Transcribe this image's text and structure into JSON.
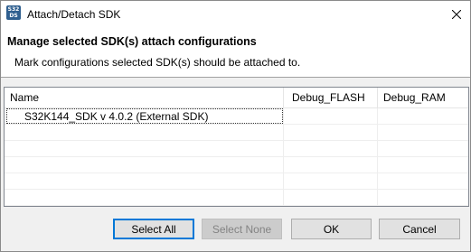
{
  "window": {
    "title": "Attach/Detach SDK",
    "icon_text": "S32 DS"
  },
  "header": {
    "title": "Manage selected SDK(s) attach configurations",
    "description": "Mark configurations selected SDK(s) should be attached to."
  },
  "table": {
    "columns": [
      "Name",
      "Debug_FLASH",
      "Debug_RAM"
    ],
    "rows": [
      {
        "name": "S32K144_SDK v 4.0.2 (External SDK)",
        "debug_flash": "",
        "debug_ram": ""
      }
    ]
  },
  "buttons": {
    "select_all": "Select All",
    "select_none": "Select None",
    "ok": "OK",
    "cancel": "Cancel"
  }
}
